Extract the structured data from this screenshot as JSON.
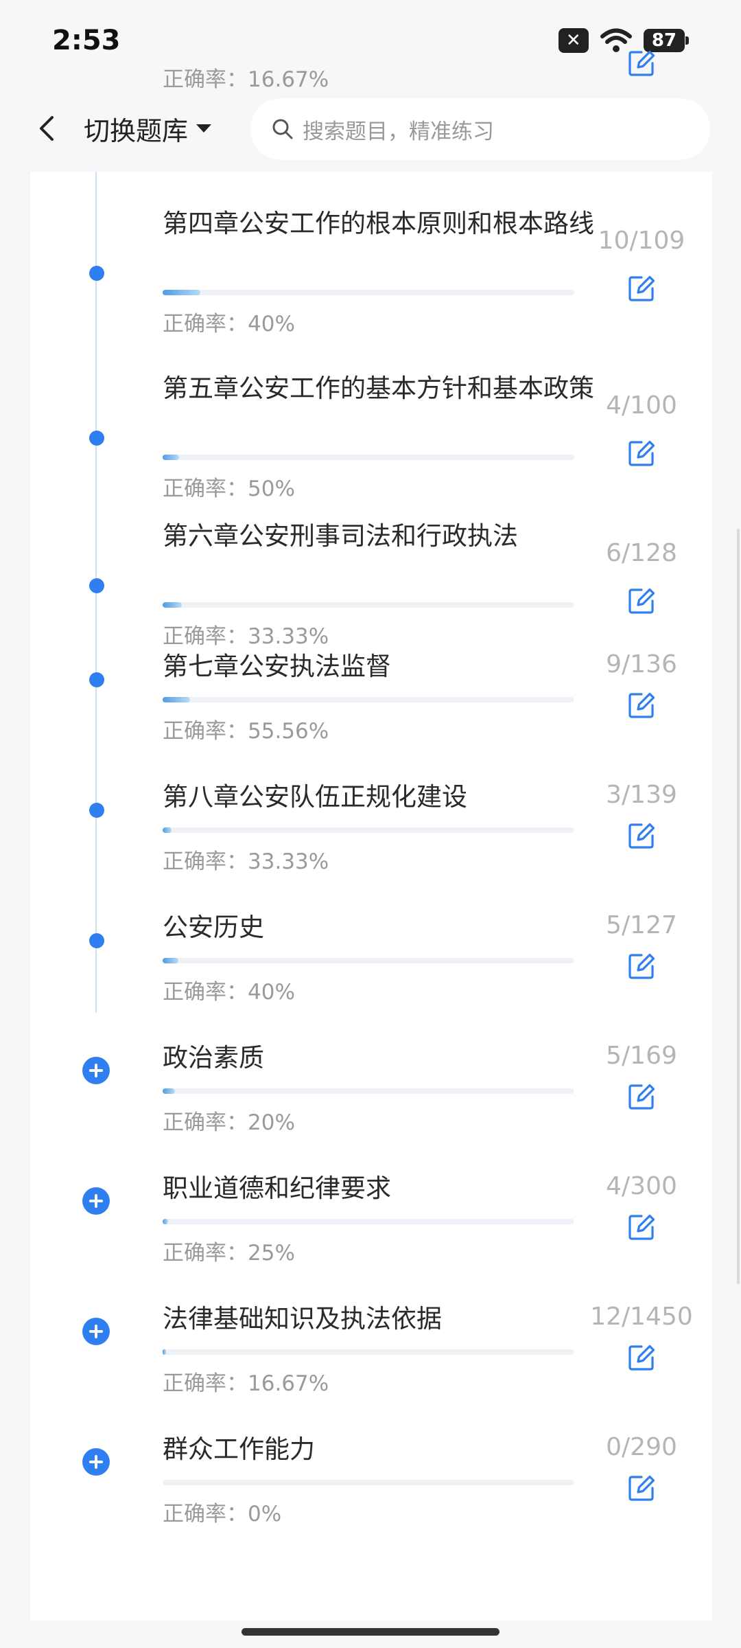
{
  "status_bar": {
    "time": "2:53",
    "battery": "87"
  },
  "header": {
    "bank_switch_label": "切换题库",
    "search_placeholder": "搜索题目，精准练习"
  },
  "colors": {
    "accent": "#2f7ff0",
    "muted": "#9a9a9a"
  },
  "chapters": [
    {
      "title": "",
      "accuracy": "正确率：16.67%",
      "count": "",
      "progress": 0,
      "marker": "none"
    },
    {
      "title": "第四章公安工作的根本原则和根本路线",
      "accuracy": "正确率：40%",
      "count": "10/109",
      "progress": 0.092,
      "marker": "dot"
    },
    {
      "title": "第五章公安工作的基本方针和基本政策",
      "accuracy": "正确率：50%",
      "count": "4/100",
      "progress": 0.04,
      "marker": "dot"
    },
    {
      "title": "第六章公安刑事司法和行政执法",
      "accuracy": "正确率：33.33%",
      "count": "6/128",
      "progress": 0.047,
      "marker": "dot"
    },
    {
      "title": "第七章公安执法监督",
      "accuracy": "正确率：55.56%",
      "count": "9/136",
      "progress": 0.066,
      "marker": "dot"
    },
    {
      "title": "第八章公安队伍正规化建设",
      "accuracy": "正确率：33.33%",
      "count": "3/139",
      "progress": 0.022,
      "marker": "dot"
    },
    {
      "title": "公安历史",
      "accuracy": "正确率：40%",
      "count": "5/127",
      "progress": 0.039,
      "marker": "dot"
    },
    {
      "title": "政治素质",
      "accuracy": "正确率：20%",
      "count": "5/169",
      "progress": 0.03,
      "marker": "plus"
    },
    {
      "title": "职业道德和纪律要求",
      "accuracy": "正确率：25%",
      "count": "4/300",
      "progress": 0.013,
      "marker": "plus"
    },
    {
      "title": "法律基础知识及执法依据",
      "accuracy": "正确率：16.67%",
      "count": "12/1450",
      "progress": 0.008,
      "marker": "plus"
    },
    {
      "title": "群众工作能力",
      "accuracy": "正确率：0%",
      "count": "0/290",
      "progress": 0,
      "marker": "plus"
    }
  ]
}
